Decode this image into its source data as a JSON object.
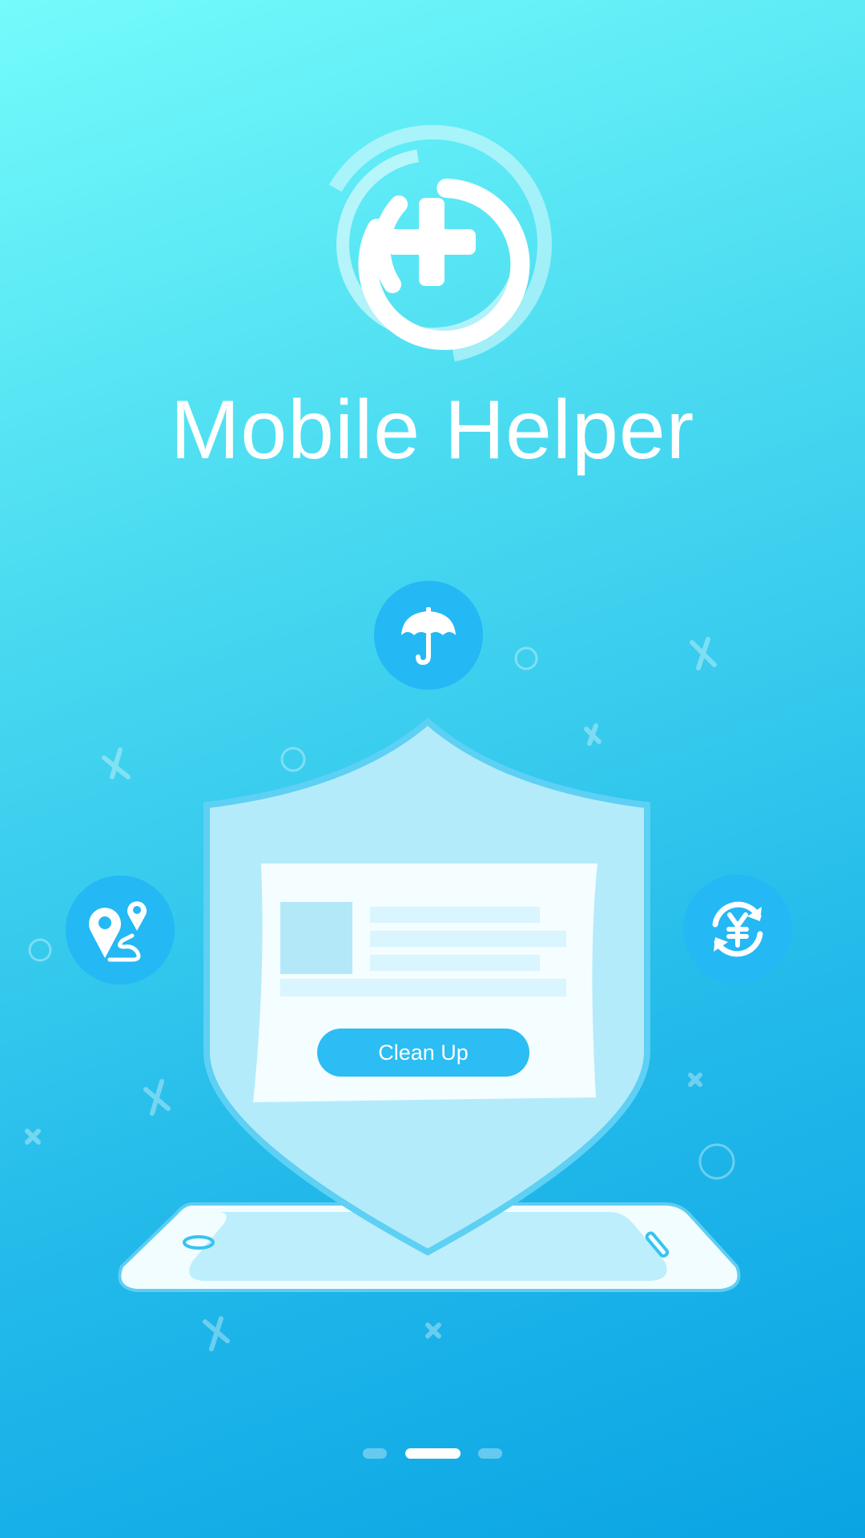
{
  "app": {
    "title": "Mobile Helper"
  },
  "card": {
    "button_label": "Clean Up"
  },
  "features": [
    {
      "icon": "umbrella-icon"
    },
    {
      "icon": "location-route-icon"
    },
    {
      "icon": "yuan-exchange-icon"
    }
  ],
  "pager": {
    "count": 3,
    "active_index": 1
  },
  "colors": {
    "accent": "#24b8f5",
    "shield": "#b4ebfb",
    "white": "#ffffff"
  }
}
